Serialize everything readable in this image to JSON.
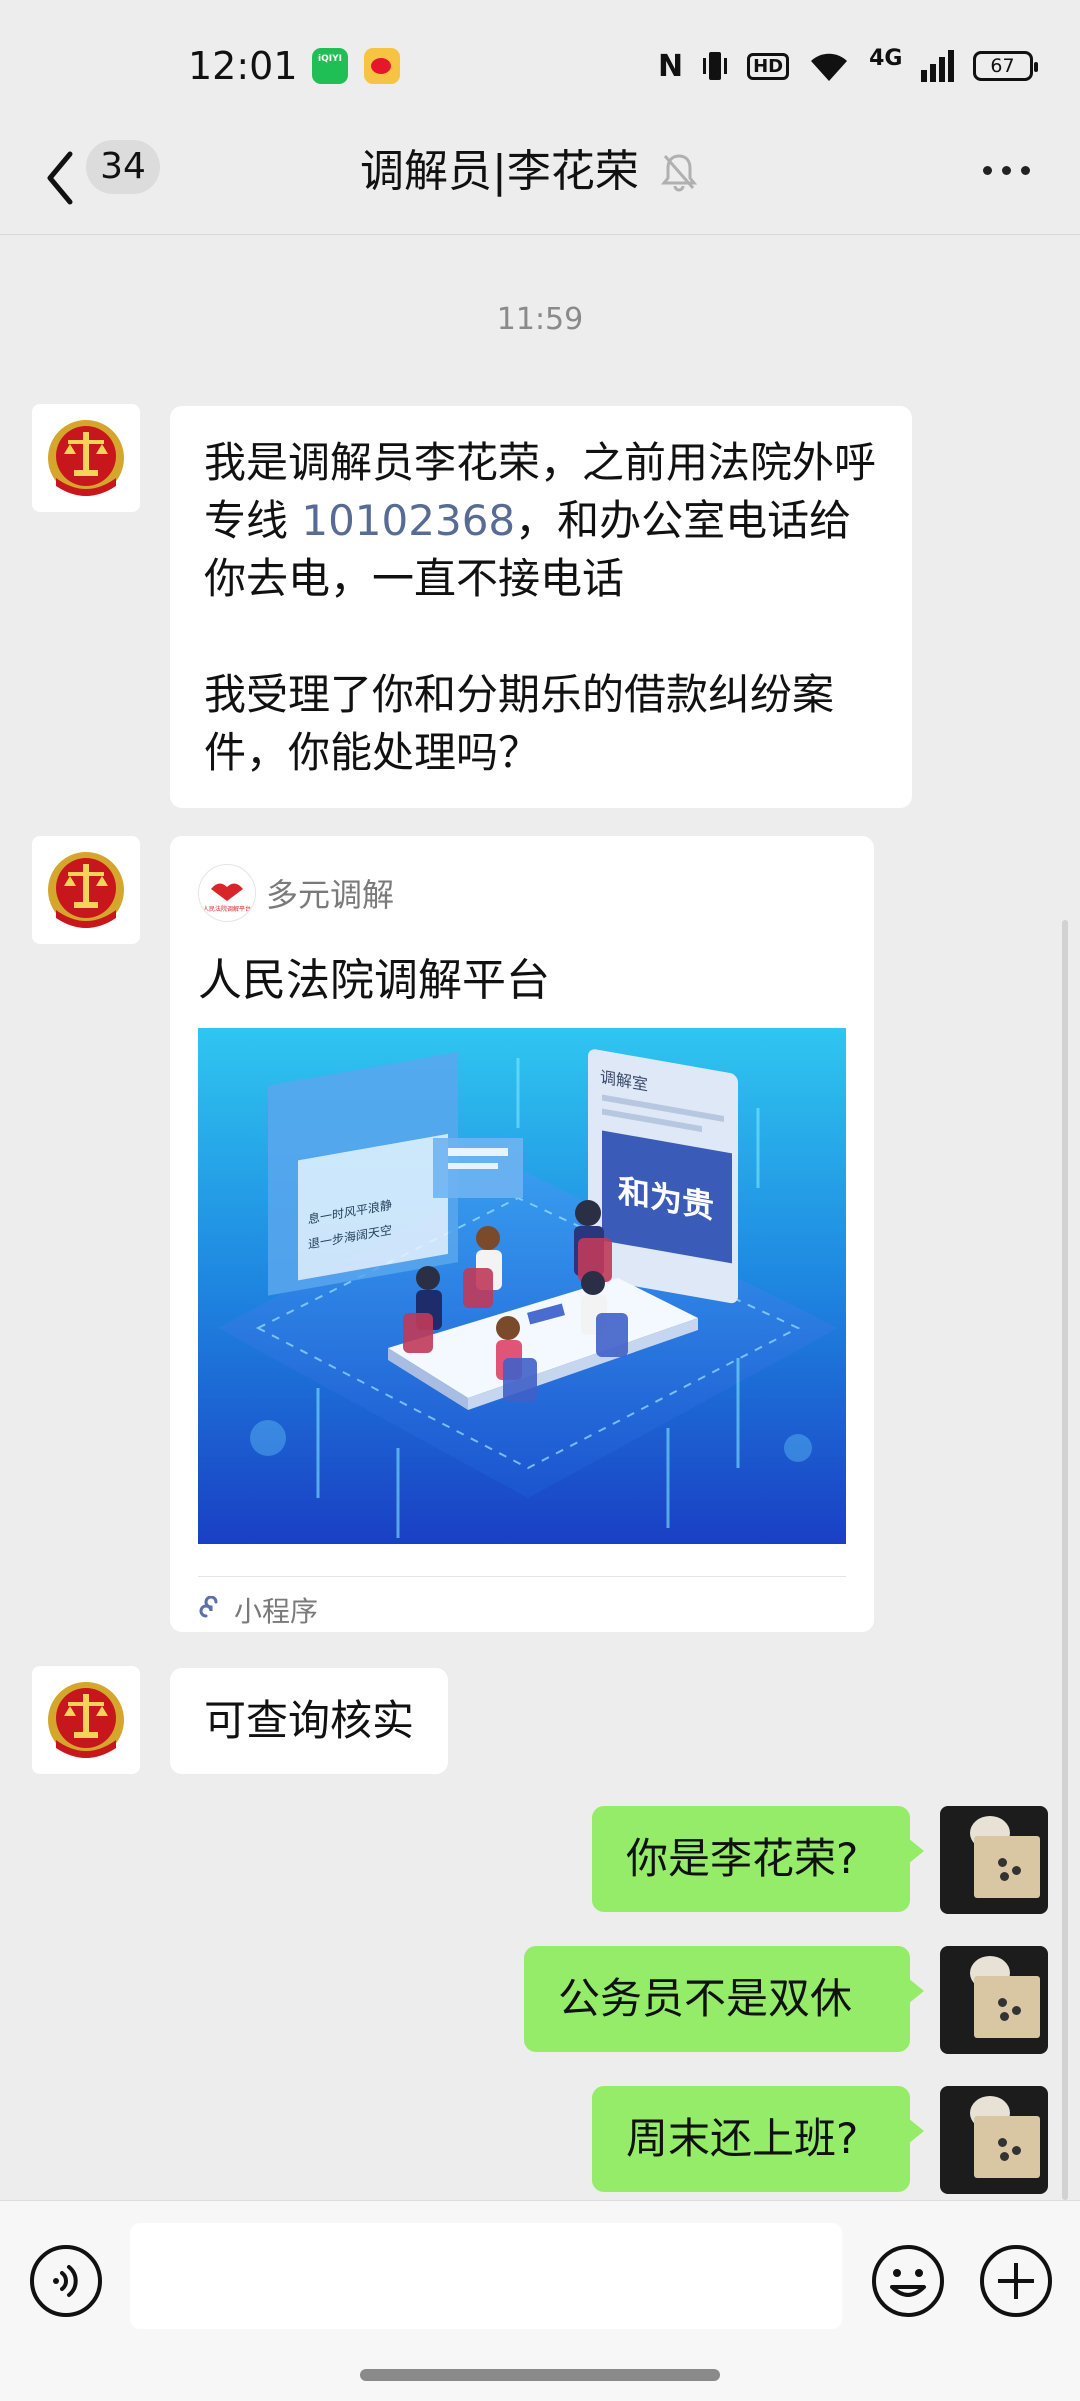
{
  "status_bar": {
    "time": "12:01",
    "iqiyi_label": "iQIYI",
    "network": "4G",
    "battery": "67",
    "hd": "HD"
  },
  "header": {
    "unread_count": "34",
    "title": "调解员|李花荣",
    "icons": [
      "back-icon",
      "mute-icon",
      "more-icon"
    ]
  },
  "chat": {
    "timestamp": "11:59",
    "messages": [
      {
        "side": "left",
        "text_part1": "我是调解员李花荣，之前用法院外呼专线 ",
        "phone": "10102368",
        "text_part2": "，和办公室电话给你去电，一直不接电话",
        "text_para2": "我受理了你和分期乐的借款纠纷案件，你能处理吗？"
      },
      {
        "side": "left",
        "type": "mini-program",
        "source": "多元调解",
        "logo_text": "人民法院调解平台",
        "title": "人民法院调解平台",
        "image_sign": "调解室",
        "image_banner": "和为贵",
        "image_board_line1": "息一时风平浪静",
        "image_board_line2": "退一步海阔天空",
        "footer": "小程序"
      },
      {
        "side": "left",
        "text": "可查询核实"
      },
      {
        "side": "right",
        "text": "你是李花荣?"
      },
      {
        "side": "right",
        "text": "公务员不是双休"
      },
      {
        "side": "right",
        "text": "周末还上班?"
      }
    ]
  },
  "input": {
    "placeholder": "",
    "icons": [
      "voice-icon",
      "emoji-icon",
      "plus-icon"
    ]
  },
  "colors": {
    "bg": "#ededed",
    "bubble_right": "#95ec69",
    "bubble_left": "#ffffff",
    "link": "#576b95"
  }
}
